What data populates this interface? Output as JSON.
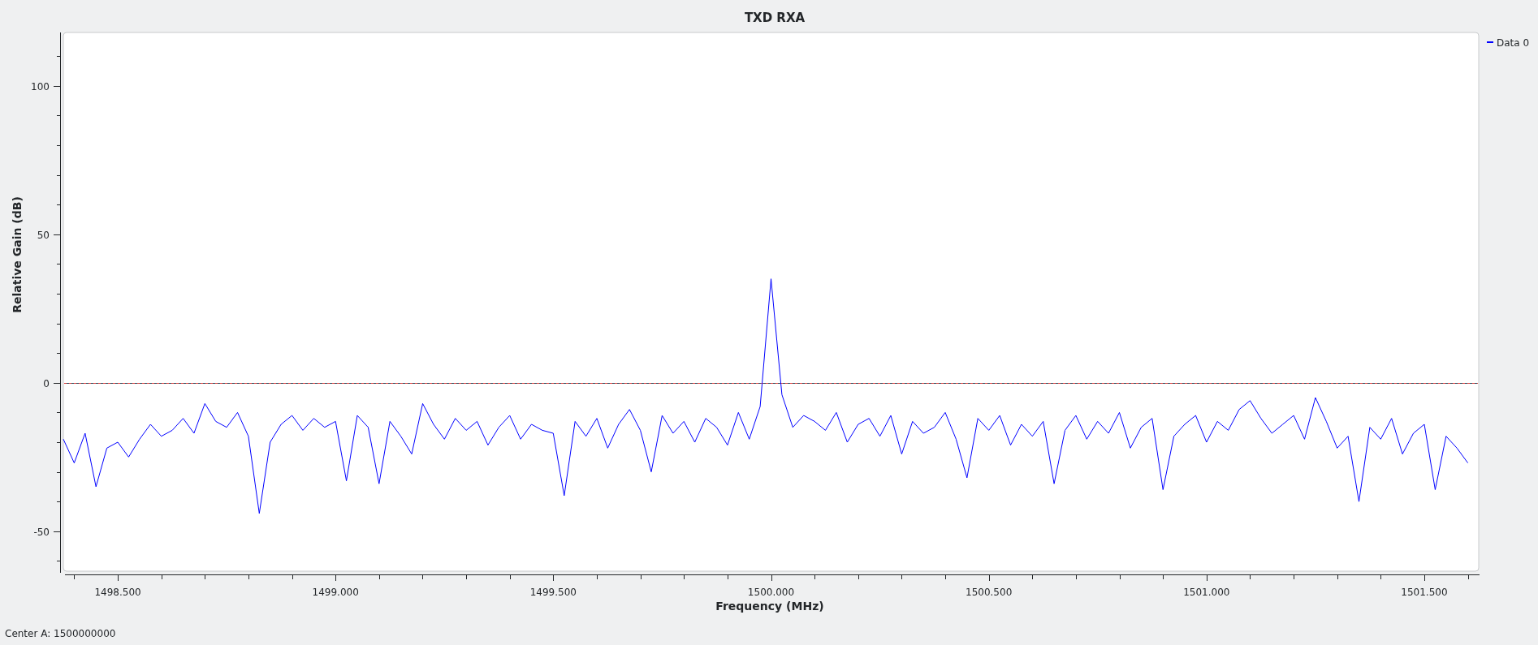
{
  "chart": {
    "chart_data": {
      "type": "line",
      "title": "TXD RXA",
      "xlabel": "Frequency (MHz)",
      "ylabel": "Relative Gain (dB)",
      "x": [
        1498.375,
        1498.4,
        1498.425,
        1498.45,
        1498.475,
        1498.5,
        1498.525,
        1498.55,
        1498.575,
        1498.6,
        1498.625,
        1498.65,
        1498.675,
        1498.7,
        1498.725,
        1498.75,
        1498.775,
        1498.8,
        1498.825,
        1498.85,
        1498.875,
        1498.9,
        1498.925,
        1498.95,
        1498.975,
        1499,
        1499.025,
        1499.05,
        1499.075,
        1499.1,
        1499.125,
        1499.15,
        1499.175,
        1499.2,
        1499.225,
        1499.25,
        1499.275,
        1499.3,
        1499.325,
        1499.35,
        1499.375,
        1499.4,
        1499.425,
        1499.45,
        1499.475,
        1499.5,
        1499.525,
        1499.55,
        1499.575,
        1499.6,
        1499.625,
        1499.65,
        1499.675,
        1499.7,
        1499.725,
        1499.75,
        1499.775,
        1499.8,
        1499.825,
        1499.85,
        1499.875,
        1499.9,
        1499.925,
        1499.95,
        1499.975,
        1500,
        1500.025,
        1500.05,
        1500.075,
        1500.1,
        1500.125,
        1500.15,
        1500.175,
        1500.2,
        1500.225,
        1500.25,
        1500.275,
        1500.3,
        1500.325,
        1500.35,
        1500.375,
        1500.4,
        1500.425,
        1500.45,
        1500.475,
        1500.5,
        1500.525,
        1500.55,
        1500.575,
        1500.6,
        1500.625,
        1500.65,
        1500.675,
        1500.7,
        1500.725,
        1500.75,
        1500.775,
        1500.8,
        1500.825,
        1500.85,
        1500.875,
        1500.9,
        1500.925,
        1500.95,
        1500.975,
        1501,
        1501.025,
        1501.05,
        1501.075,
        1501.1,
        1501.125,
        1501.15,
        1501.175,
        1501.2,
        1501.225,
        1501.25,
        1501.275,
        1501.3,
        1501.325,
        1501.35,
        1501.375,
        1501.4,
        1501.425,
        1501.45,
        1501.475,
        1501.5,
        1501.525,
        1501.55,
        1501.575,
        1501.6
      ],
      "series": [
        {
          "name": "Data 0",
          "color": "#0000ff",
          "values": [
            -19,
            -27,
            -17,
            -35,
            -22,
            -20,
            -25,
            -19,
            -14,
            -18,
            -16,
            -12,
            -17,
            -7,
            -13,
            -15,
            -10,
            -18,
            -44,
            -20,
            -14,
            -11,
            -16,
            -12,
            -15,
            -13,
            -33,
            -11,
            -15,
            -34,
            -13,
            -18,
            -24,
            -7,
            -14,
            -19,
            -12,
            -16,
            -13,
            -21,
            -15,
            -11,
            -19,
            -14,
            -16,
            -17,
            -38,
            -13,
            -18,
            -12,
            -22,
            -14,
            -9,
            -16,
            -30,
            -11,
            -17,
            -13,
            -20,
            -12,
            -15,
            -21,
            -10,
            -19,
            -8,
            35,
            -4,
            -15,
            -11,
            -13,
            -16,
            -10,
            -20,
            -14,
            -12,
            -18,
            -11,
            -24,
            -13,
            -17,
            -15,
            -10,
            -19,
            -32,
            -12,
            -16,
            -11,
            -21,
            -14,
            -18,
            -13,
            -34,
            -16,
            -11,
            -19,
            -13,
            -17,
            -10,
            -22,
            -15,
            -12,
            -36,
            -18,
            -14,
            -11,
            -20,
            -13,
            -16,
            -9,
            -6,
            -12,
            -17,
            -14,
            -11,
            -19,
            -5,
            -13,
            -22,
            -18,
            -40,
            -15,
            -19,
            -12,
            -24,
            -17,
            -14,
            -36,
            -18,
            -22,
            -27
          ]
        }
      ],
      "xlim": [
        1498.375,
        1501.625
      ],
      "ylim": [
        -64,
        118
      ],
      "ref_lines": [
        {
          "axis": "y",
          "value": 0,
          "color": "#e04040"
        }
      ],
      "xticks": [
        {
          "value": 1498.5,
          "label": "1498.500"
        },
        {
          "value": 1499,
          "label": "1499.000"
        },
        {
          "value": 1499.5,
          "label": "1499.500"
        },
        {
          "value": 1500,
          "label": "1500.000"
        },
        {
          "value": 1500.5,
          "label": "1500.500"
        },
        {
          "value": 1501,
          "label": "1501.000"
        },
        {
          "value": 1501.5,
          "label": "1501.500"
        }
      ],
      "yticks": [
        -50,
        0,
        50,
        100
      ]
    }
  },
  "status": "Center A: 1500000000"
}
